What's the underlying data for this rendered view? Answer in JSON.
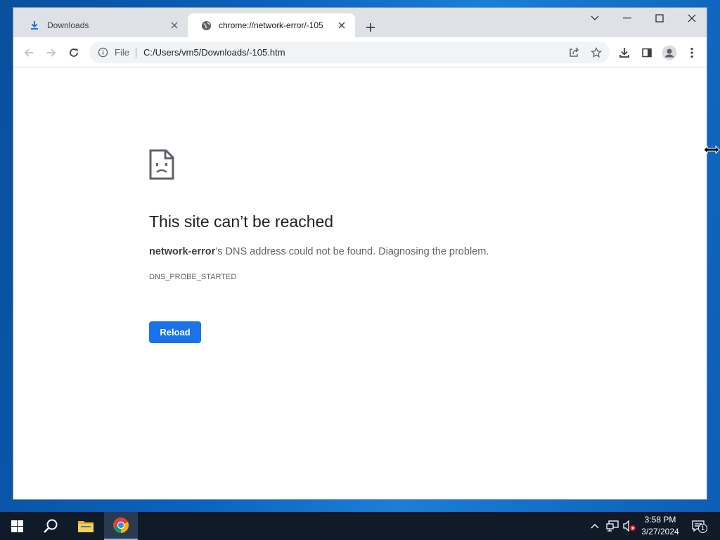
{
  "browser": {
    "tabs": [
      {
        "title": "Downloads",
        "icon": "download-icon",
        "active": false
      },
      {
        "title": "chrome://network-error/-105",
        "icon": "globe-icon",
        "active": true
      }
    ],
    "address_bar": {
      "scheme_chip": "File",
      "url": "C:/Users/vm5/Downloads/-105.htm"
    }
  },
  "error_page": {
    "title": "This site can’t be reached",
    "host": "network-error",
    "description": "’s DNS address could not be found. Diagnosing the problem.",
    "error_code": "DNS_PROBE_STARTED",
    "reload_label": "Reload"
  },
  "taskbar": {
    "time": "3:58 PM",
    "date": "3/27/2024",
    "notification_count": "1"
  },
  "colors": {
    "accent": "#1a73e8",
    "tabstrip": "#dee1e6",
    "taskbar": "#101b2a"
  }
}
